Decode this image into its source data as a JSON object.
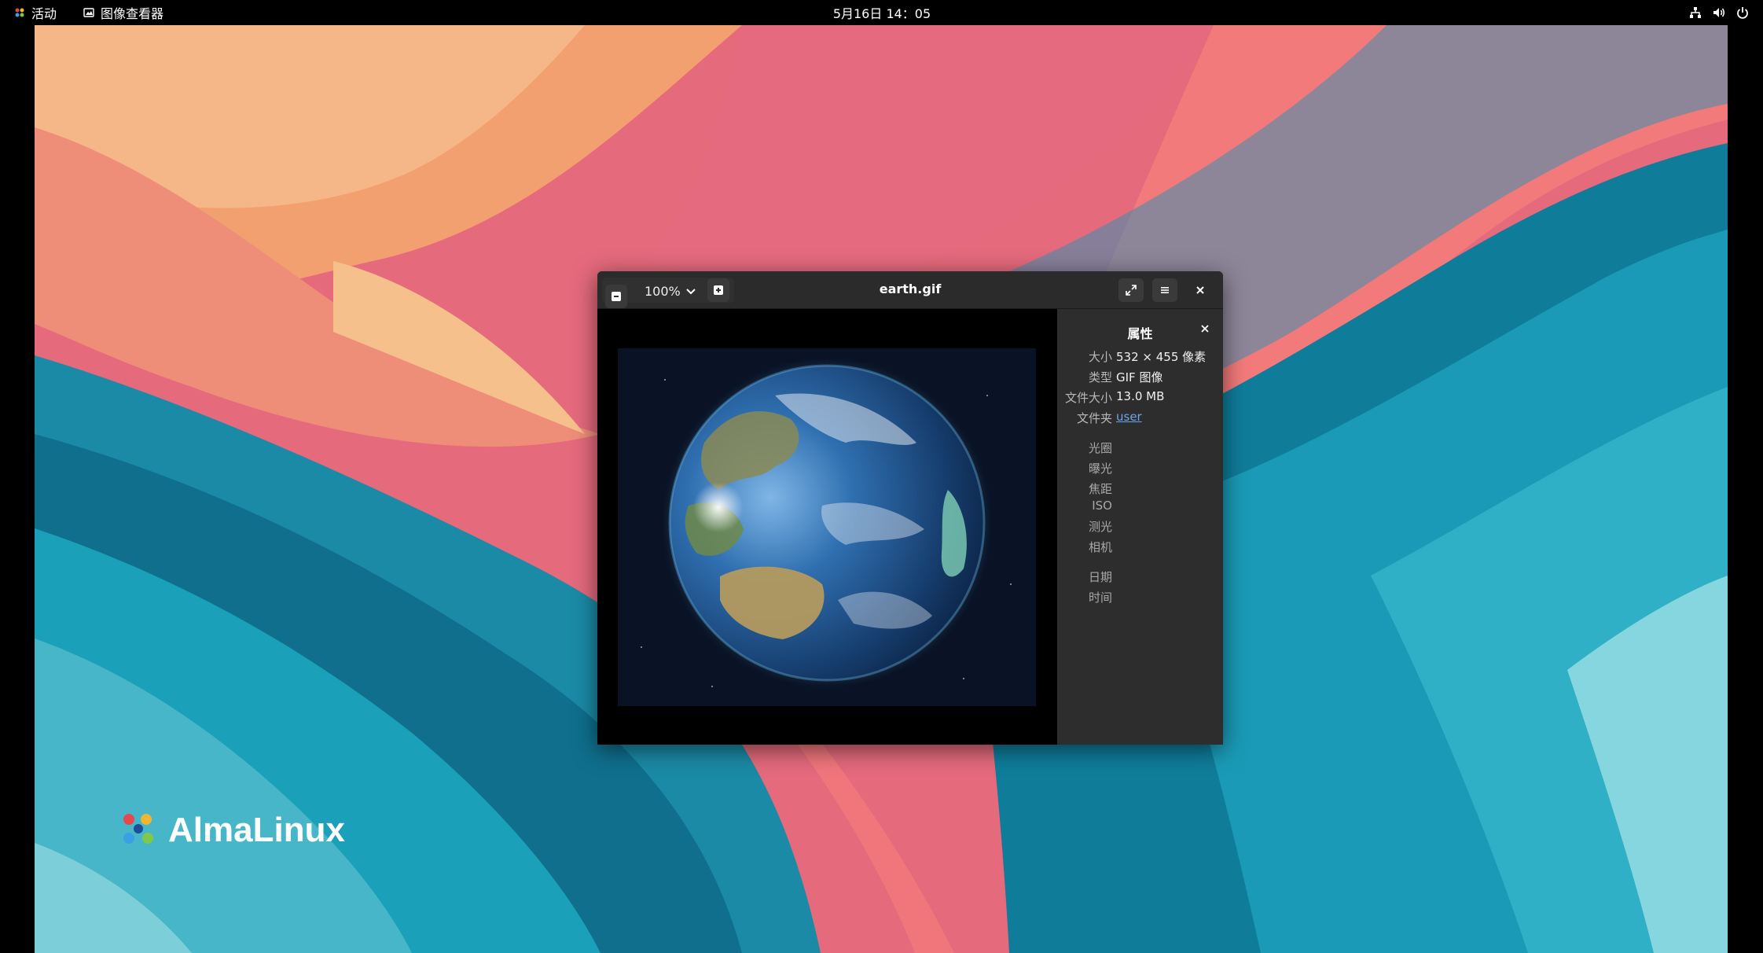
{
  "topbar": {
    "activities": "活动",
    "app_name": "图像查看器",
    "clock": "5月16日 14：05",
    "tray_icons": [
      "network-icon",
      "volume-icon",
      "power-icon"
    ]
  },
  "desktop": {
    "logo_text": "AlmaLinux"
  },
  "window": {
    "title": "earth.gif",
    "zoom_level": "100%",
    "panel_title": "属性",
    "properties": [
      {
        "key": "大小",
        "value": "532 × 455 像素"
      },
      {
        "key": "类型",
        "value": "GIF 图像"
      },
      {
        "key": "文件大小",
        "value": "13.0 MB"
      },
      {
        "key": "文件夹",
        "value": "user"
      }
    ],
    "exif_labels": [
      "光圈",
      "曝光",
      "焦距",
      "ISO",
      "测光",
      "相机"
    ],
    "date_labels": [
      "日期",
      "时间"
    ]
  },
  "colors": {
    "accent_link": "#6aa6e8",
    "headerbar": "#2b2b2b",
    "panel": "#2d2d2d"
  }
}
